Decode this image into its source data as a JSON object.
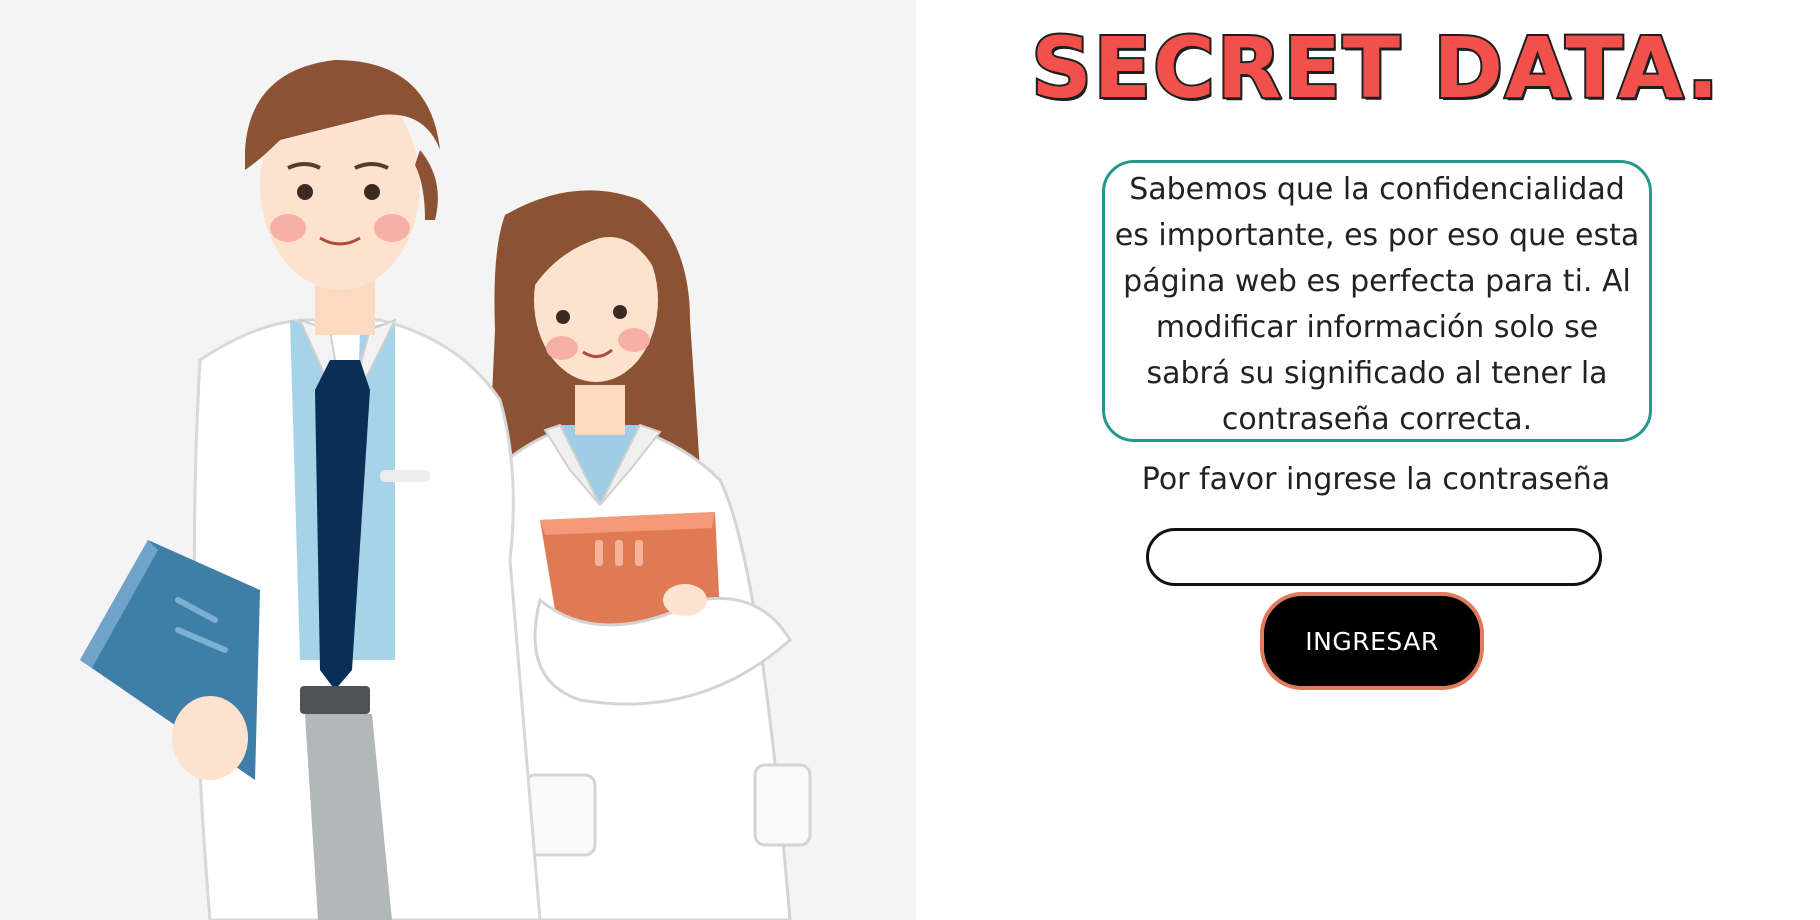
{
  "header": {
    "title": "SECRET DATA."
  },
  "intro": {
    "text": "Sabemos que la confidencialidad es importante, es por eso que esta página web es perfecta para ti. Al modificar información solo se sabrá su significado al tener la contraseña correcta."
  },
  "login": {
    "prompt": "Por favor ingrese la contraseña",
    "password_value": "",
    "submit_label": "INGRESAR"
  },
  "colors": {
    "title": "#f2504b",
    "title_outline": "#1f1f1f",
    "intro_border": "#22998c",
    "button_bg": "#000000",
    "button_border": "#e27a5e",
    "hero_bg": "#f4f4f4"
  },
  "icons": {
    "hero": "doctors-illustration"
  }
}
